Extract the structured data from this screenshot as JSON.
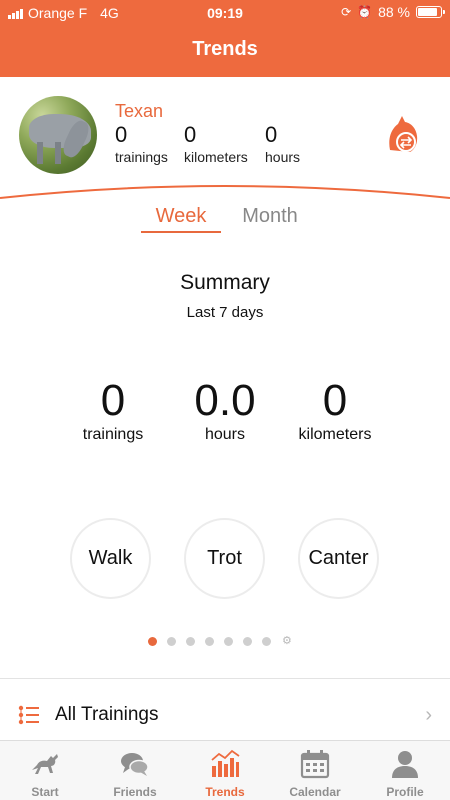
{
  "status_bar": {
    "carrier": "Orange F",
    "network": "4G",
    "time": "09:19",
    "battery": "88 %",
    "battery_level": 0.88
  },
  "nav": {
    "title": "Trends"
  },
  "profile": {
    "horse_name": "Texan",
    "stats": [
      {
        "value": "0",
        "label": "trainings"
      },
      {
        "value": "0",
        "label": "kilometers"
      },
      {
        "value": "0",
        "label": "hours"
      }
    ],
    "switch_icon": "horse-swap-icon"
  },
  "tabs": {
    "week": "Week",
    "month": "Month",
    "active": "week"
  },
  "summary": {
    "title": "Summary",
    "subtitle": "Last 7 days",
    "stats": [
      {
        "value": "0",
        "label": "trainings"
      },
      {
        "value": "0.0",
        "label": "hours"
      },
      {
        "value": "0",
        "label": "kilometers"
      }
    ]
  },
  "gaits": [
    "Walk",
    "Trot",
    "Canter"
  ],
  "pager": {
    "pages": 8,
    "active_index": 0,
    "last_is_settings": true
  },
  "all_trainings": {
    "label": "All Trainings"
  },
  "tab_bar": [
    {
      "label": "Start",
      "icon": "running-horse-icon"
    },
    {
      "label": "Friends",
      "icon": "chat-bubbles-icon"
    },
    {
      "label": "Trends",
      "icon": "bar-chart-icon",
      "active": true
    },
    {
      "label": "Calendar",
      "icon": "calendar-icon"
    },
    {
      "label": "Profile",
      "icon": "person-icon"
    }
  ],
  "colors": {
    "accent": "#ee6a3e",
    "tab_inactive": "#8e8e8e"
  }
}
